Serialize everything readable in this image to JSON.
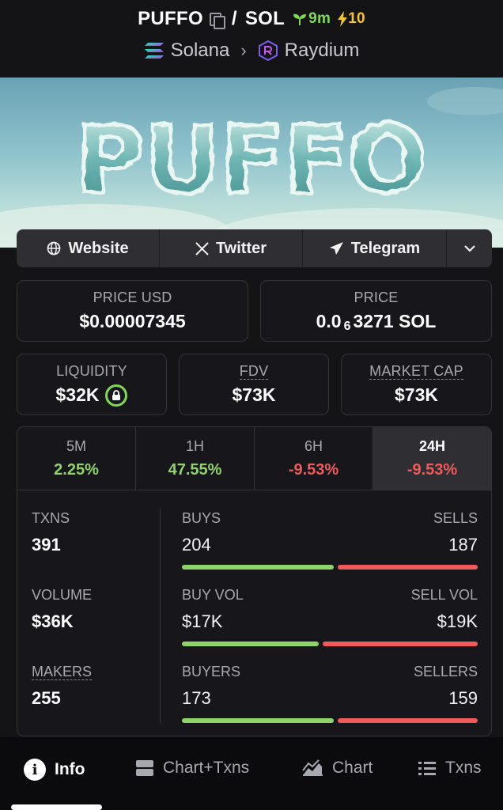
{
  "header": {
    "token": "PUFFO",
    "quote": "SOL",
    "age": "9m",
    "boost": "10",
    "chain": "Solana",
    "dex": "Raydium"
  },
  "banner": {
    "text": "PUFFO"
  },
  "social": {
    "website": "Website",
    "twitter": "Twitter",
    "telegram": "Telegram"
  },
  "stats": {
    "price_usd_label": "PRICE USD",
    "price_usd": "$0.00007345",
    "price_label": "PRICE",
    "price_prefix": "0.0",
    "price_zeros": "6",
    "price_rest": "3271 SOL",
    "liquidity_label": "LIQUIDITY",
    "liquidity": "$32K",
    "fdv_label": "FDV",
    "fdv": "$73K",
    "mcap_label": "MARKET CAP",
    "mcap": "$73K"
  },
  "timeframes": [
    {
      "label": "5M",
      "change": "2.25%"
    },
    {
      "label": "1H",
      "change": "47.55%"
    },
    {
      "label": "6H",
      "change": "-9.53%"
    },
    {
      "label": "24H",
      "change": "-9.53%"
    }
  ],
  "metrics": {
    "txns_label": "TXNS",
    "txns": "391",
    "buys_label": "BUYS",
    "buys": "204",
    "sells_label": "SELLS",
    "sells": "187",
    "volume_label": "VOLUME",
    "volume": "$36K",
    "buy_vol_label": "BUY VOL",
    "buy_vol": "$17K",
    "sell_vol_label": "SELL VOL",
    "sell_vol": "$19K",
    "makers_label": "MAKERS",
    "makers": "255",
    "buyers_label": "BUYERS",
    "buyers": "173",
    "sellers_label": "SELLERS",
    "sellers": "159"
  },
  "ratios": {
    "txns_buy": 0.52,
    "vol_buy": 0.47,
    "makers_buy": 0.52
  },
  "nav": {
    "info": "Info",
    "chart_txns": "Chart+Txns",
    "chart": "Chart",
    "txns": "Txns"
  },
  "colors": {
    "positive": "#8fd46a",
    "negative": "#f05a5a",
    "age_green": "#7fd856",
    "boost_yellow": "#f5c62a"
  },
  "icons": [
    "copy-icon",
    "sprout-icon",
    "bolt-icon",
    "solana-icon",
    "chevron-right-icon",
    "raydium-icon",
    "globe-icon",
    "x-icon",
    "telegram-icon",
    "chevron-down-icon",
    "lock-icon",
    "info-icon",
    "chart-txns-icon",
    "chart-icon",
    "list-icon"
  ]
}
